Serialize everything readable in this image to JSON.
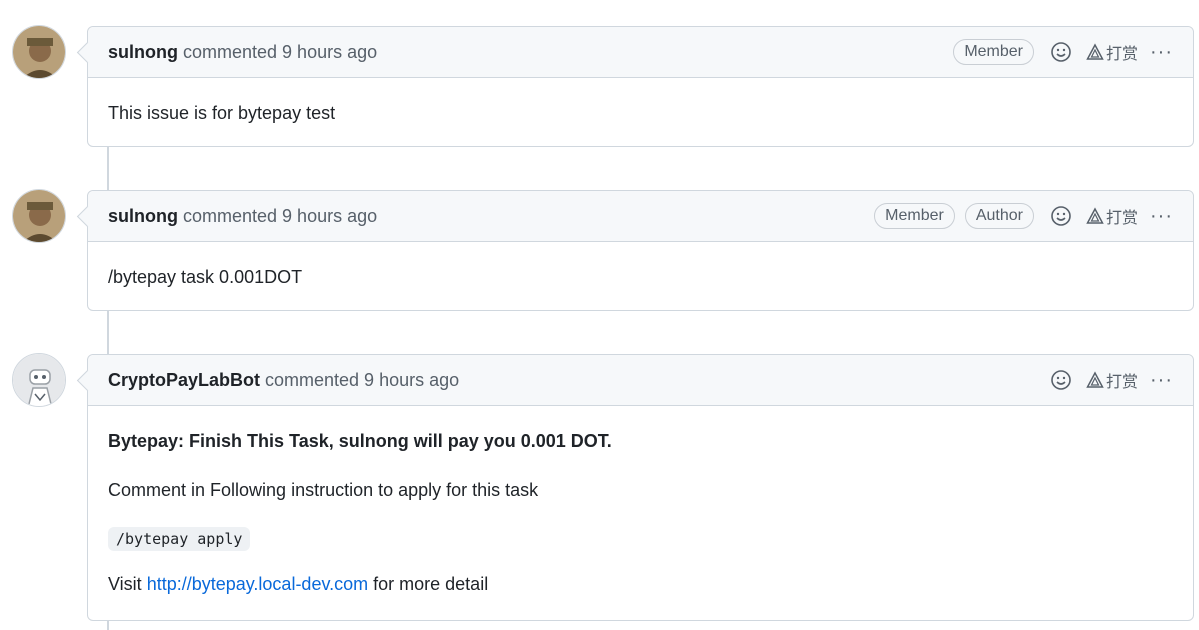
{
  "comments": [
    {
      "author": "sulnong",
      "action": " commented 9 hours ago",
      "badges": [
        "Member"
      ],
      "reward_label": "打赏",
      "more_label": "···",
      "body": "This issue is for bytepay test"
    },
    {
      "author": "sulnong",
      "action": " commented 9 hours ago",
      "badges": [
        "Member",
        "Author"
      ],
      "reward_label": "打赏",
      "more_label": "···",
      "body": "/bytepay task 0.001DOT"
    },
    {
      "author": "CryptoPayLabBot",
      "action": " commented 9 hours ago",
      "badges": [],
      "reward_label": "打赏",
      "more_label": "···",
      "body_title": "Bytepay: Finish This Task, sulnong will pay you 0.001 DOT.",
      "body_instruction": "Comment in Following instruction to apply for this task",
      "body_code": "/bytepay apply",
      "body_visit_prefix": "Visit ",
      "body_link": "http://bytepay.local-dev.com",
      "body_visit_suffix": " for more detail"
    }
  ],
  "icons": {
    "emoji": "smiley-icon",
    "reward": "triangle-reward-icon",
    "more": "kebab-horizontal-icon",
    "avatar_user": "user-avatar",
    "avatar_bot": "bot-avatar"
  },
  "colors": {
    "link": "#0969da",
    "header_bg": "#f6f8fa",
    "border": "#d0d7de"
  }
}
